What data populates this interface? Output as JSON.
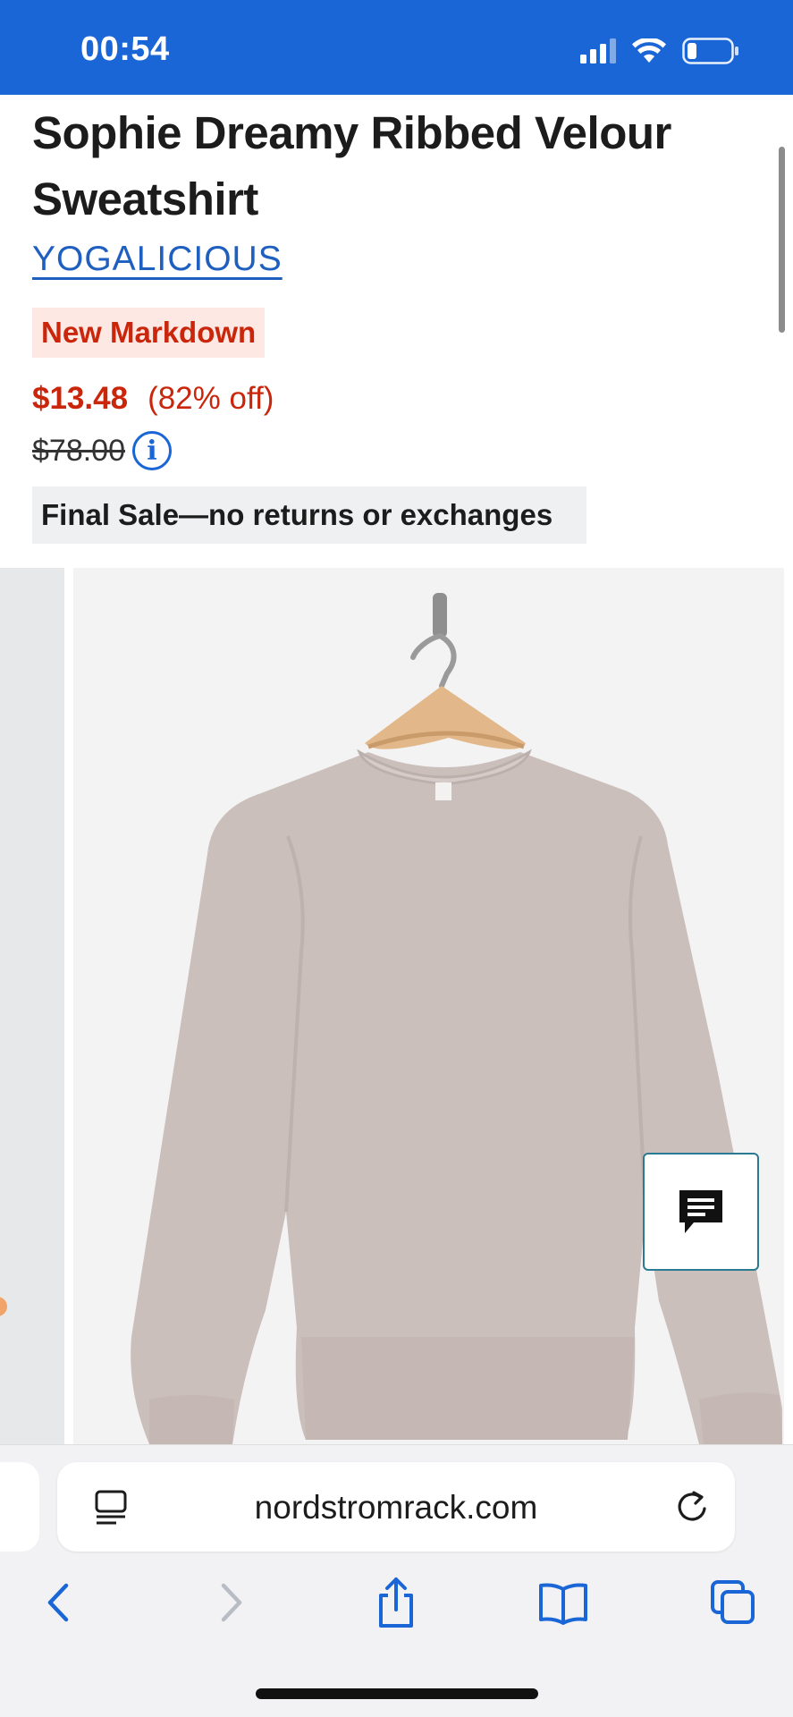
{
  "status_bar": {
    "time": "00:54",
    "icons": [
      "signal-icon",
      "wifi-icon",
      "battery-icon"
    ]
  },
  "product": {
    "title": "Sophie Dreamy Ribbed Velour Sweatshirt",
    "brand": "YOGALICIOUS",
    "badge": "New Markdown",
    "price_current": "$13.48",
    "price_off": "(82% off)",
    "price_original": "$78.00",
    "final_sale": "Final Sale—no returns or exchanges"
  },
  "gallery": {
    "image_subject": "sweatshirt-on-hanger",
    "icons": [
      "chat-icon"
    ]
  },
  "browser": {
    "url": "nordstromrack.com",
    "icons": [
      "reader-icon",
      "reload-icon",
      "back-icon",
      "forward-icon",
      "share-icon",
      "bookmarks-icon",
      "tabs-icon"
    ]
  },
  "colors": {
    "accent": "#1a66d6",
    "sale": "#c9260c",
    "badge_bg": "#fde8e4",
    "sweater": "#cbbfbc"
  }
}
